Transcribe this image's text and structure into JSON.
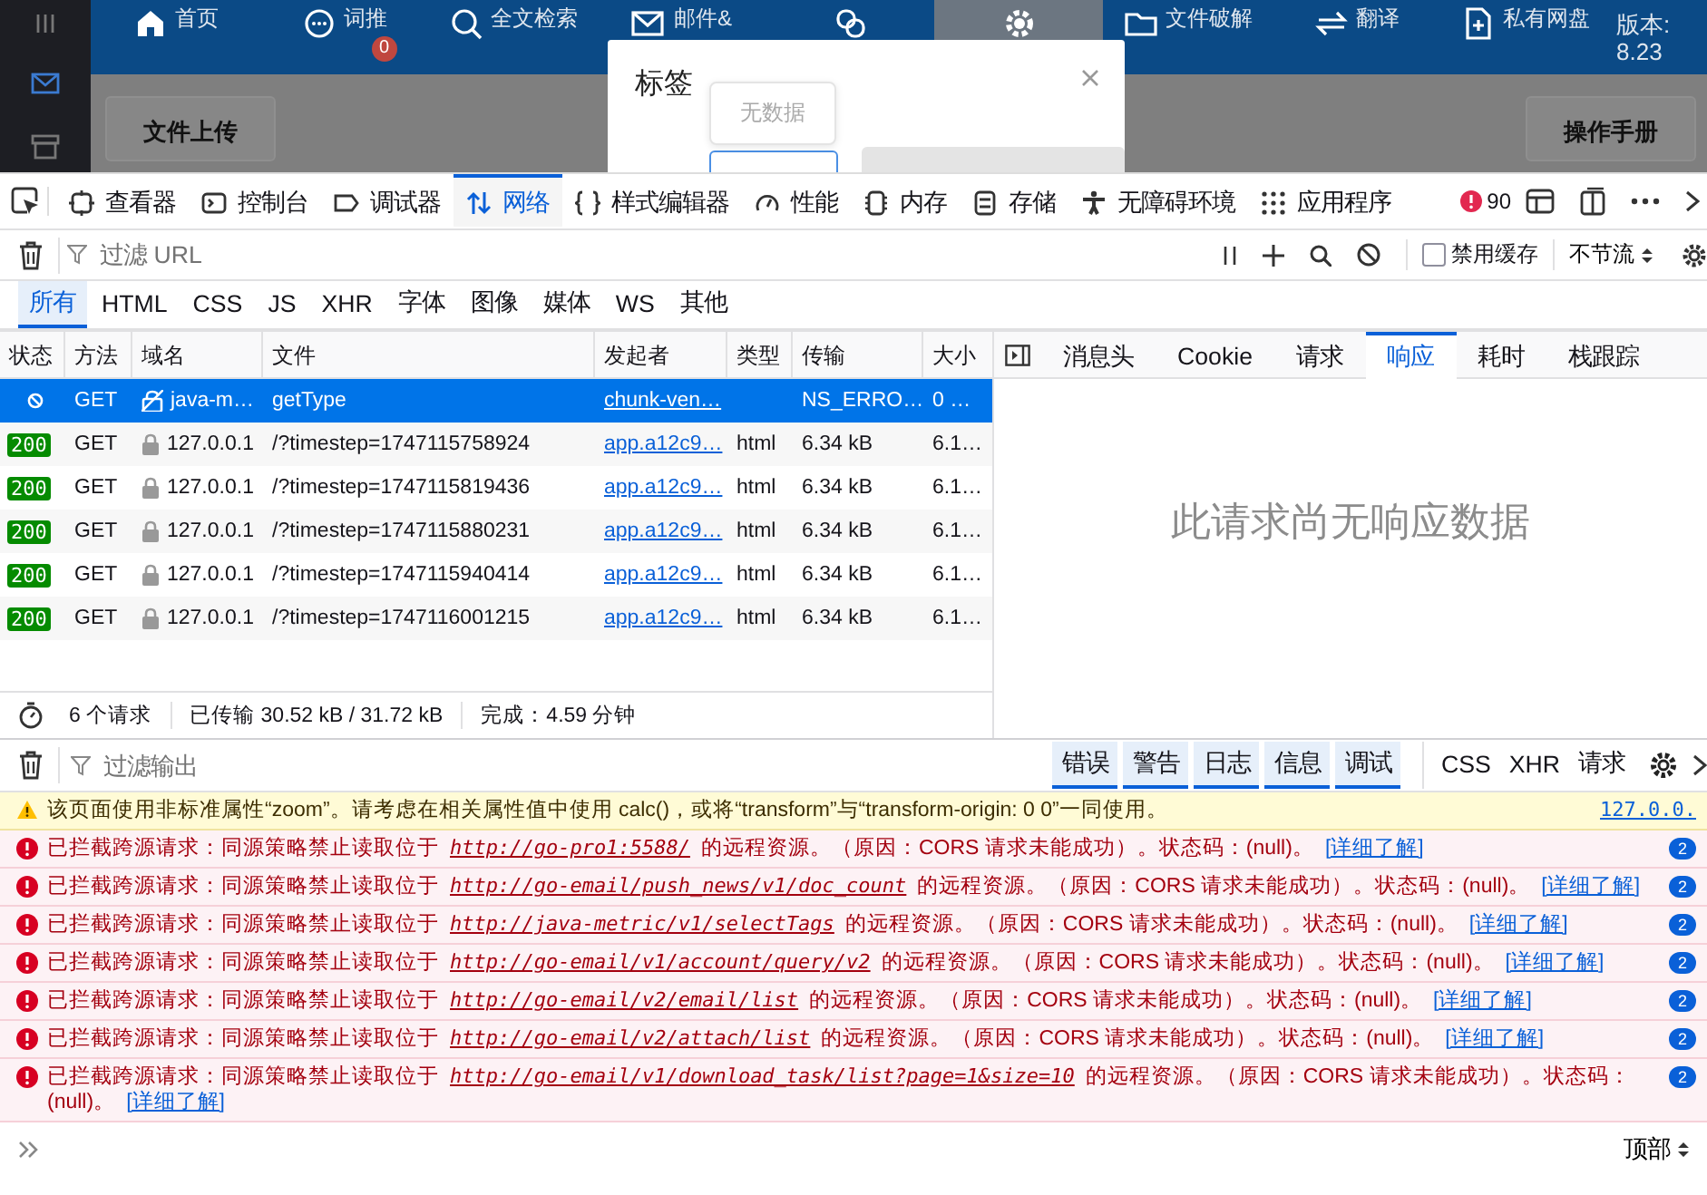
{
  "app": {
    "nav": [
      {
        "label": "首页",
        "selected": false
      },
      {
        "label": "词推",
        "badge": "0",
        "selected": false
      },
      {
        "label": "全文检索",
        "selected": false
      },
      {
        "label": "邮件&",
        "selected": false
      },
      {
        "selected": false
      },
      {
        "selected": true
      },
      {
        "label": "文件破解",
        "selected": false
      },
      {
        "label": "翻译",
        "selected": false
      },
      {
        "label": "私有网盘",
        "selected": false
      }
    ],
    "version_label": "版本:",
    "version": "8.23",
    "upload": "文件上传",
    "manual": "操作手册",
    "modal": {
      "title": "标签",
      "tooltip": "无数据"
    }
  },
  "devtools": {
    "tabs": [
      {
        "label": "查看器",
        "selected": false
      },
      {
        "label": "控制台",
        "selected": false
      },
      {
        "label": "调试器",
        "selected": false
      },
      {
        "label": "网络",
        "selected": true
      },
      {
        "label": "样式编辑器",
        "selected": false
      },
      {
        "label": "性能",
        "selected": false
      },
      {
        "label": "内存",
        "selected": false
      },
      {
        "label": "存储",
        "selected": false
      },
      {
        "label": "无障碍环境",
        "selected": false
      },
      {
        "label": "应用程序",
        "selected": false
      }
    ],
    "error_count": "90"
  },
  "network": {
    "filter": {
      "placeholder": "过滤 URL",
      "disable_cache": {
        "label": "禁用缓存",
        "checked": false
      },
      "throttle": "不节流"
    },
    "type_filters": [
      {
        "label": "所有",
        "selected": true
      },
      {
        "label": "HTML",
        "selected": false
      },
      {
        "label": "CSS",
        "selected": false
      },
      {
        "label": "JS",
        "selected": false
      },
      {
        "label": "XHR",
        "selected": false
      },
      {
        "label": "字体",
        "selected": false
      },
      {
        "label": "图像",
        "selected": false
      },
      {
        "label": "媒体",
        "selected": false
      },
      {
        "label": "WS",
        "selected": false
      },
      {
        "label": "其他",
        "selected": false
      }
    ],
    "columns": [
      "状态",
      "方法",
      "域名",
      "文件",
      "发起者",
      "类型",
      "传输",
      "大小"
    ],
    "rows": [
      {
        "kind": "blocked",
        "selected": true,
        "method": "GET",
        "domain": "java-m…",
        "file": "getType",
        "initiator": "chunk-ven…",
        "transferred": "NS_ERRO…",
        "size": "0 …"
      },
      {
        "kind": "ok",
        "status": "200",
        "selected": false,
        "method": "GET",
        "domain": "127.0.0.1",
        "file": "/?timestep=1747115758924",
        "initiator": "app.a12c9…",
        "type": "html",
        "transferred": "6.34 kB",
        "size": "6.1…"
      },
      {
        "kind": "ok",
        "status": "200",
        "selected": false,
        "method": "GET",
        "domain": "127.0.0.1",
        "file": "/?timestep=1747115819436",
        "initiator": "app.a12c9…",
        "type": "html",
        "transferred": "6.34 kB",
        "size": "6.1…"
      },
      {
        "kind": "ok",
        "status": "200",
        "selected": false,
        "method": "GET",
        "domain": "127.0.0.1",
        "file": "/?timestep=1747115880231",
        "initiator": "app.a12c9…",
        "type": "html",
        "transferred": "6.34 kB",
        "size": "6.1…"
      },
      {
        "kind": "ok",
        "status": "200",
        "selected": false,
        "method": "GET",
        "domain": "127.0.0.1",
        "file": "/?timestep=1747115940414",
        "initiator": "app.a12c9…",
        "type": "html",
        "transferred": "6.34 kB",
        "size": "6.1…"
      },
      {
        "kind": "ok",
        "status": "200",
        "selected": false,
        "method": "GET",
        "domain": "127.0.0.1",
        "file": "/?timestep=1747116001215",
        "initiator": "app.a12c9…",
        "type": "html",
        "transferred": "6.34 kB",
        "size": "6.1…"
      }
    ],
    "detail": {
      "tabs": [
        {
          "label": "消息头",
          "selected": false
        },
        {
          "label": "Cookie",
          "selected": false
        },
        {
          "label": "请求",
          "selected": false
        },
        {
          "label": "响应",
          "selected": true
        },
        {
          "label": "耗时",
          "selected": false
        },
        {
          "label": "栈跟踪",
          "selected": false
        }
      ],
      "empty": "此请求尚无响应数据"
    },
    "summary": {
      "requests": "6 个请求",
      "transferred": "已传输 30.52 kB / 31.72 kB",
      "finish": "完成：4.59 分钟"
    }
  },
  "console": {
    "filter_placeholder": "过滤输出",
    "levels": [
      {
        "label": "错误",
        "selected": true
      },
      {
        "label": "警告",
        "selected": true
      },
      {
        "label": "日志",
        "selected": true
      },
      {
        "label": "信息",
        "selected": true
      },
      {
        "label": "调试",
        "selected": true
      }
    ],
    "extras": [
      {
        "label": "CSS",
        "selected": false
      },
      {
        "label": "XHR",
        "selected": false
      },
      {
        "label": "请求",
        "selected": false
      }
    ],
    "messages": [
      {
        "kind": "warning",
        "text": "该页面使用非标准属性“zoom”。请考虑在相关属性值中使用 calc()，或将“transform”与“transform-origin: 0 0”一同使用。",
        "source": "127.0.0."
      },
      {
        "kind": "error",
        "prefix": "已拦截跨源请求：同源策略禁止读取位于",
        "url": "http://go-pro1:5588/",
        "suffix": "的远程资源。（原因：CORS 请求未能成功）。状态码：(null)。",
        "more": "[详细了解]",
        "count": "2"
      },
      {
        "kind": "error",
        "prefix": "已拦截跨源请求：同源策略禁止读取位于",
        "url": "http://go-email/push_news/v1/doc_count",
        "suffix": "的远程资源。（原因：CORS 请求未能成功）。状态码：(null)。",
        "more": "[详细了解]",
        "count": "2"
      },
      {
        "kind": "error",
        "prefix": "已拦截跨源请求：同源策略禁止读取位于",
        "url": "http://java-metric/v1/selectTags",
        "suffix": "的远程资源。（原因：CORS 请求未能成功）。状态码：(null)。",
        "more": "[详细了解]",
        "count": "2"
      },
      {
        "kind": "error",
        "prefix": "已拦截跨源请求：同源策略禁止读取位于",
        "url": "http://go-email/v1/account/query/v2",
        "suffix": "的远程资源。（原因：CORS 请求未能成功）。状态码：(null)。",
        "more": "[详细了解]",
        "count": "2"
      },
      {
        "kind": "error",
        "prefix": "已拦截跨源请求：同源策略禁止读取位于",
        "url": "http://go-email/v2/email/list",
        "suffix": "的远程资源。（原因：CORS 请求未能成功）。状态码：(null)。",
        "more": "[详细了解]",
        "count": "2"
      },
      {
        "kind": "error",
        "prefix": "已拦截跨源请求：同源策略禁止读取位于",
        "url": "http://go-email/v2/attach/list",
        "suffix": "的远程资源。（原因：CORS 请求未能成功）。状态码：(null)。",
        "more": "[详细了解]",
        "count": "2"
      },
      {
        "kind": "error",
        "prefix": "已拦截跨源请求：同源策略禁止读取位于",
        "url": "http://go-email/v1/download_task/list?page=1&size=10",
        "suffix": "的远程资源。（原因：CORS 请求未能成功）。状态码：(null)。",
        "more": "[详细了解]",
        "count": "2"
      }
    ],
    "context": "顶部"
  }
}
